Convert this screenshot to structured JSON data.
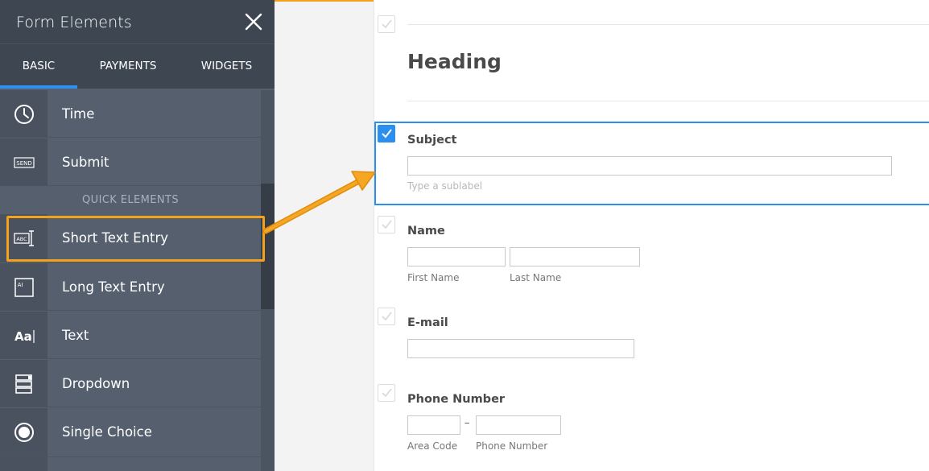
{
  "sidebar": {
    "title": "Form Elements",
    "tabs": [
      {
        "label": "BASIC",
        "active": true
      },
      {
        "label": "PAYMENTS",
        "active": false
      },
      {
        "label": "WIDGETS",
        "active": false
      }
    ],
    "quick_elements_label": "QUICK ELEMENTS",
    "items": [
      {
        "label": "Time",
        "icon": "clock-icon"
      },
      {
        "label": "Submit",
        "icon": "send-icon",
        "icon_text": "SEND"
      },
      {
        "label": "Short Text Entry",
        "icon": "short-text-icon",
        "icon_text": "ABC",
        "highlighted": true
      },
      {
        "label": "Long Text Entry",
        "icon": "long-text-icon",
        "icon_text": "AI"
      },
      {
        "label": "Text",
        "icon": "text-icon",
        "icon_text": "Aa"
      },
      {
        "label": "Dropdown",
        "icon": "dropdown-icon"
      },
      {
        "label": "Single Choice",
        "icon": "radio-icon"
      }
    ]
  },
  "form": {
    "heading": "Heading",
    "subject": {
      "label": "Subject",
      "sublabel": "Type a sublabel"
    },
    "name": {
      "label": "Name",
      "first_sublabel": "First Name",
      "last_sublabel": "Last Name"
    },
    "email": {
      "label": "E-mail"
    },
    "phone": {
      "label": "Phone Number",
      "separator": "–",
      "area_sublabel": "Area Code",
      "number_sublabel": "Phone Number"
    }
  },
  "colors": {
    "sidebar_bg": "#555f6e",
    "sidebar_header": "#3e4652",
    "accent_blue": "#2b8ff0",
    "highlight_orange": "#f2a31b"
  }
}
